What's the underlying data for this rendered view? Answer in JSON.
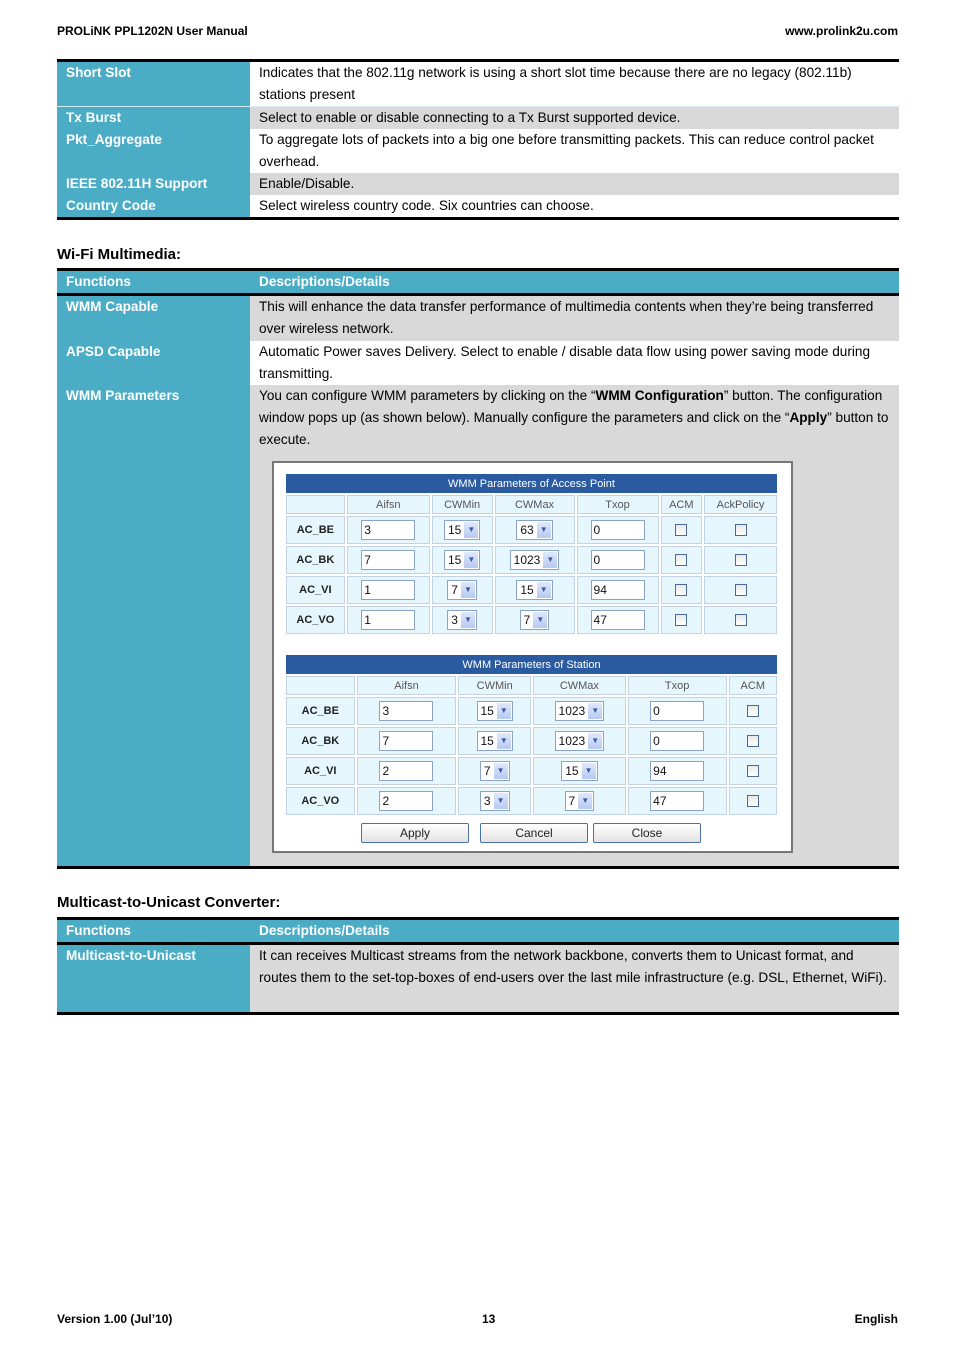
{
  "header": {
    "left": "PROLiNK PPL1202N User Manual",
    "right": "www.prolink2u.com"
  },
  "footer": {
    "left": "Version 1.00 (Jul’10)",
    "center": "13",
    "right": "English"
  },
  "table1": [
    {
      "fn": "Short Slot",
      "desc": "Indicates that the 802.11g network is using a short slot time because there are no legacy (802.11b) stations present",
      "gray": false
    },
    {
      "fn": "Tx Burst",
      "desc": "Select to enable or disable connecting to a Tx Burst supported device.",
      "gray": true
    },
    {
      "fn": "Pkt_Aggregate",
      "desc": "To aggregate lots of packets into a big one before transmitting packets. This can reduce control packet overhead.",
      "gray": false
    },
    {
      "fn": "IEEE 802.11H Support",
      "desc": "Enable/Disable.",
      "gray": true
    },
    {
      "fn": "Country Code",
      "desc": "Select wireless country code. Six countries can choose.",
      "gray": false
    }
  ],
  "wmm": {
    "title": "Wi-Fi Multimedia:",
    "head": {
      "fn": "Functions",
      "desc": "Descriptions/Details"
    },
    "rows": [
      {
        "fn": "WMM Capable",
        "desc": "This will enhance the data transfer performance of multimedia contents when they’re being transferred over wireless network."
      },
      {
        "fn": "APSD Capable",
        "desc": "Automatic Power saves Delivery. Select to enable / disable data flow using power saving mode during transmitting."
      }
    ],
    "params": {
      "fn": "WMM Parameters",
      "d1": "You can configure WMM parameters by clicking on the “",
      "b1": "WMM Configuration",
      "d2": "” button. The configuration window pops up (as shown below). Manually configure the parameters and click on the “",
      "b2": "Apply",
      "d3": "” button to execute."
    }
  },
  "dialog": {
    "ap": {
      "title": "WMM Parameters of Access Point",
      "columns": [
        "",
        "Aifsn",
        "CWMin",
        "CWMax",
        "Txop",
        "ACM",
        "AckPolicy"
      ],
      "rows": [
        {
          "ac": "AC_BE",
          "aifsn": "3",
          "cwmin": "15",
          "cwmax": "63",
          "txop": "0",
          "acm": false,
          "ack": false
        },
        {
          "ac": "AC_BK",
          "aifsn": "7",
          "cwmin": "15",
          "cwmax": "1023",
          "txop": "0",
          "acm": false,
          "ack": false
        },
        {
          "ac": "AC_VI",
          "aifsn": "1",
          "cwmin": "7",
          "cwmax": "15",
          "txop": "94",
          "acm": false,
          "ack": false
        },
        {
          "ac": "AC_VO",
          "aifsn": "1",
          "cwmin": "3",
          "cwmax": "7",
          "txop": "47",
          "acm": false,
          "ack": false
        }
      ]
    },
    "sta": {
      "title": "WMM Parameters of Station",
      "columns": [
        "",
        "Aifsn",
        "CWMin",
        "CWMax",
        "Txop",
        "ACM"
      ],
      "rows": [
        {
          "ac": "AC_BE",
          "aifsn": "3",
          "cwmin": "15",
          "cwmax": "1023",
          "txop": "0",
          "acm": false
        },
        {
          "ac": "AC_BK",
          "aifsn": "7",
          "cwmin": "15",
          "cwmax": "1023",
          "txop": "0",
          "acm": false
        },
        {
          "ac": "AC_VI",
          "aifsn": "2",
          "cwmin": "7",
          "cwmax": "15",
          "txop": "94",
          "acm": false
        },
        {
          "ac": "AC_VO",
          "aifsn": "2",
          "cwmin": "3",
          "cwmax": "7",
          "txop": "47",
          "acm": false
        }
      ]
    },
    "buttons": {
      "apply": "Apply",
      "cancel": "Cancel",
      "close": "Close"
    },
    "colors": {
      "title_bar": "#2a5aa0",
      "cell": "#e6f6fd"
    }
  },
  "m2u": {
    "title": "Multicast-to-Unicast Converter:",
    "head": {
      "fn": "Functions",
      "desc": "Descriptions/Details"
    },
    "row": {
      "fn": "Multicast-to-Unicast",
      "desc": "It can receives Multicast streams from the network backbone, converts them to Unicast format, and routes them to the set-top-boxes of end-users over the last mile infrastructure (e.g. DSL, Ethernet, WiFi)."
    }
  },
  "colors": {
    "function_column": "#4bacc6",
    "gray_row": "#d9d9d9"
  }
}
